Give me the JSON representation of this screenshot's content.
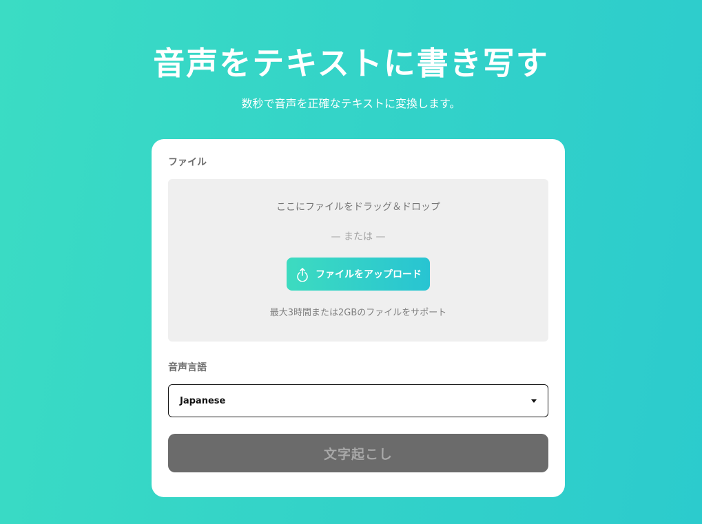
{
  "hero": {
    "title": "音声をテキストに書き写す",
    "subtitle": "数秒で音声を正確なテキストに変換します。"
  },
  "file_section": {
    "label": "ファイル",
    "drop_text": "ここにファイルをドラッグ＆ドロップ",
    "or_text": "— または —",
    "upload_button": "ファイルをアップロード",
    "upload_icon": "upload-icon",
    "support_text": "最大3時間または2GBのファイルをサポート"
  },
  "language_section": {
    "label": "音声言語",
    "selected": "Japanese"
  },
  "transcribe_button": "文字起こし",
  "colors": {
    "background_start": "#3bdcc4",
    "background_end": "#2ccbcd",
    "card": "#ffffff",
    "dropzone": "#efefef",
    "upload_gradient_start": "#3ddbc0",
    "upload_gradient_end": "#28c4d2",
    "transcribe_button_bg": "#6b6b6b",
    "transcribe_button_text": "#a8a8a8"
  }
}
